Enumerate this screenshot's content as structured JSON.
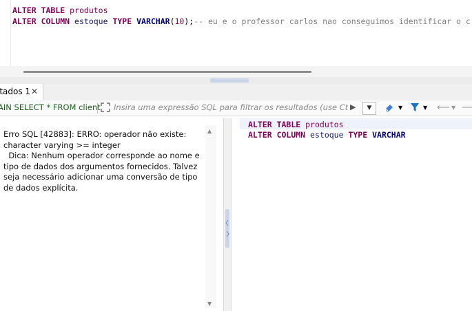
{
  "editor": {
    "line1": {
      "kw1": "ALTER",
      "kw2": "TABLE",
      "ident": "produtos"
    },
    "line2": {
      "kw1": "ALTER",
      "kw2": "COLUMN",
      "ident": "estoque",
      "kw3": "TYPE",
      "kw4": "VARCHAR",
      "open": "(",
      "num": "10",
      "close": ");",
      "comment": "-- eu e o professor carlos nao conseguimos identificar o c"
    }
  },
  "tabs": [
    {
      "label": "ltados 1",
      "close_icon": "close-icon"
    }
  ],
  "filter": {
    "explain_label": "AIN SELECT * FROM client",
    "placeholder": "Insira uma expressão SQL para filtrar os resultados (use Ctrl+Esp",
    "icons": [
      "expand-icon",
      "run-icon",
      "chevron-down-icon",
      "eraser-icon",
      "filter-icon",
      "back-arrow-icon",
      "forward-arrow-icon"
    ]
  },
  "error": {
    "line1": "Erro SQL [42883]: ERRO: operador não existe: character varying >= integer",
    "line2": "  Dica: Nenhum operador corresponde ao nome e tipo de dados dos argumentos fornecidos. Talvez seja necessário adicionar uma conversão de tipo de dados explícita."
  },
  "query_preview": {
    "line1": {
      "kw1": "ALTER",
      "kw2": "TABLE",
      "ident": "produtos"
    },
    "line2": {
      "kw1": "ALTER",
      "kw2": "COLUMN",
      "ident": "estoque",
      "kw3": "TYPE",
      "kw4": "VARCHAR"
    }
  },
  "colors": {
    "keyword": "#7f0055",
    "type_keyword": "#000080",
    "comment": "#808080",
    "accent": "#1a73c8"
  }
}
